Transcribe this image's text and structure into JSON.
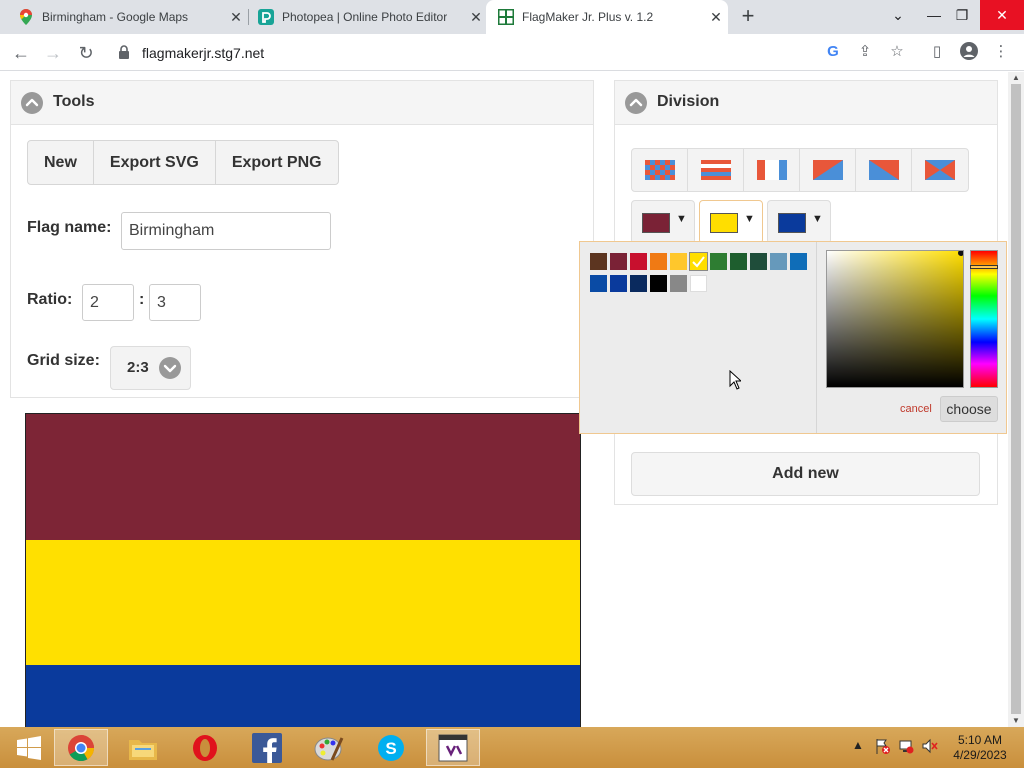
{
  "browser": {
    "tabs": [
      {
        "title": "Birmingham - Google Maps",
        "icon": "google-maps-icon"
      },
      {
        "title": "Photopea | Online Photo Editor",
        "icon": "photopea-icon"
      },
      {
        "title": "FlagMaker Jr. Plus v. 1.2",
        "icon": "flagmaker-icon",
        "active": true
      }
    ],
    "url": "flagmakerjr.stg7.net"
  },
  "tools": {
    "title": "Tools",
    "buttons": {
      "new": "New",
      "export_svg": "Export SVG",
      "export_png": "Export PNG"
    },
    "flag_name_label": "Flag name:",
    "flag_name_value": "Birmingham",
    "ratio_label": "Ratio:",
    "ratio_h": "2",
    "ratio_sep": ":",
    "ratio_w": "3",
    "grid_label": "Grid size:",
    "grid_value": "2:3"
  },
  "division": {
    "title": "Division",
    "types": [
      "checkerboard",
      "horizontal-stripes",
      "vertical-stripes",
      "diagonal-top-left",
      "diagonal-top-right",
      "saltire"
    ],
    "colors": [
      "#7a2236",
      "#ffde00",
      "#0a3a9c"
    ],
    "add_new": "Add new"
  },
  "picker": {
    "palette": [
      "#5c3520",
      "#7a2236",
      "#c8102e",
      "#f07a14",
      "#ffc72c",
      "#ffde00",
      "#2e7d32",
      "#1e5e2e",
      "#1f4d3a",
      "#6699bb",
      "#0f6db8",
      "#0a4ba5",
      "#0a3a9c",
      "#0a2a5e",
      "#000000",
      "#888888",
      "#ffffff"
    ],
    "selected_index": 5,
    "cancel": "cancel",
    "choose": "choose"
  },
  "flag": {
    "stripes": [
      "#7d2536",
      "#ffe000",
      "#0a3a9c"
    ]
  },
  "taskbar": {
    "apps": [
      "windows-start",
      "chrome",
      "file-manager",
      "opera",
      "facebook",
      "paint",
      "skype",
      "visual-studio"
    ],
    "time": "5:10 AM",
    "date": "4/29/2023"
  }
}
